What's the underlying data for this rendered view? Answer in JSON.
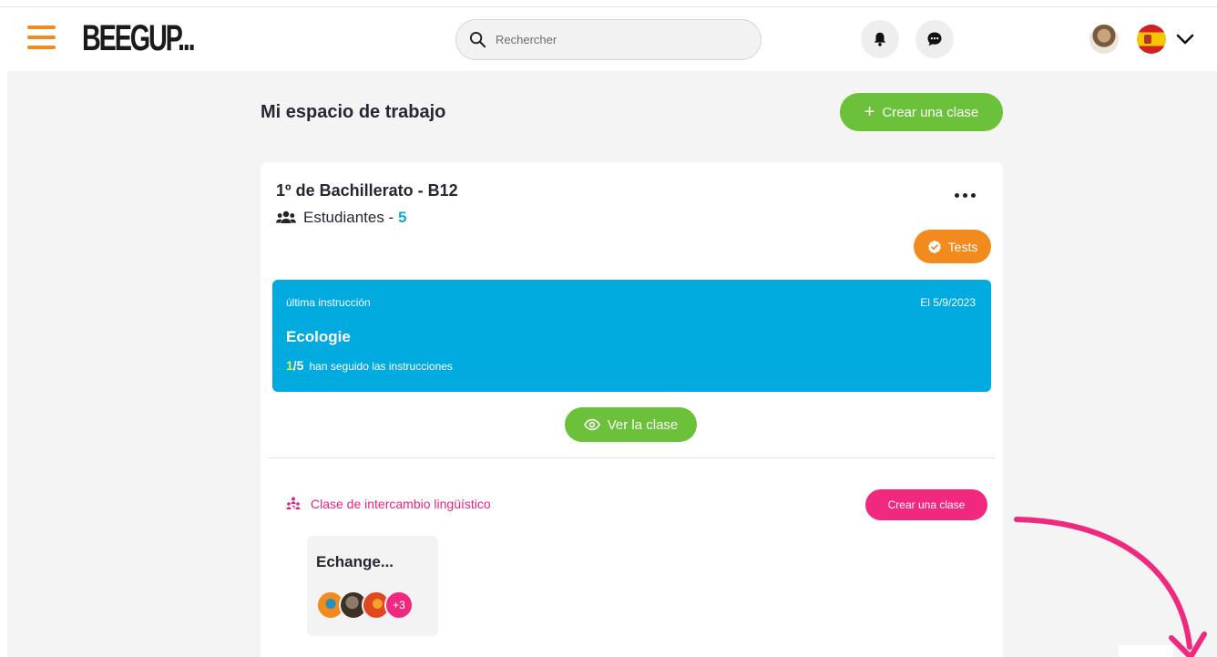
{
  "header": {
    "logo_text": "BEEGUP...",
    "search": {
      "placeholder": "Rechercher",
      "value": ""
    },
    "icons": [
      "menu-icon",
      "search-icon",
      "bell-icon",
      "chat-icon",
      "avatar",
      "spain-flag-icon",
      "chevron-down-icon"
    ]
  },
  "workspace": {
    "title": "Mi espacio de trabajo",
    "create_button": "Crear una clase"
  },
  "class_card": {
    "name": "1º de Bachillerato - B12",
    "students_label": "Estudiantes - ",
    "students_count": "5",
    "tests_button": "Tests",
    "instruction": {
      "label": "última instrucción",
      "date": "El 5/9/2023",
      "title": "Ecologie",
      "done": "1",
      "total": "/5",
      "progress_text": "han seguido las instrucciones"
    },
    "view_button": "Ver la clase",
    "exchange": {
      "label": "Clase de intercambio lingüístico",
      "create_button": "Crear una clase",
      "card_title": "Echange...",
      "more_count": "+3"
    }
  },
  "colors": {
    "orange": "#f28a1e",
    "green": "#6cc13a",
    "blue": "#01aadf",
    "pink": "#f0287e",
    "text_dark": "#2b2433"
  }
}
